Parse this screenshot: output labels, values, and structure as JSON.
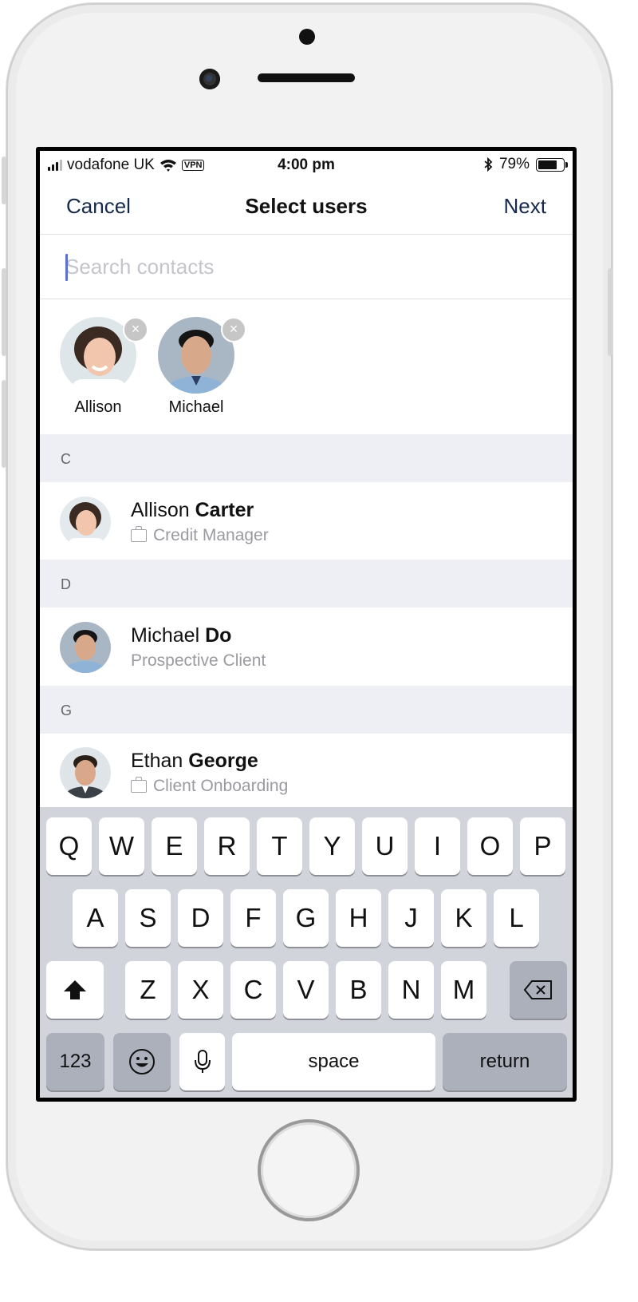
{
  "status_bar": {
    "carrier": "vodafone UK",
    "vpn": "VPN",
    "time": "4:00 pm",
    "battery": "79%",
    "battery_level": 0.79
  },
  "nav": {
    "cancel": "Cancel",
    "title": "Select users",
    "next": "Next"
  },
  "search": {
    "placeholder": "Search contacts",
    "value": ""
  },
  "selected": [
    {
      "name": "Allison"
    },
    {
      "name": "Michael"
    }
  ],
  "sections": [
    {
      "letter": "C",
      "contacts": [
        {
          "first": "Allison",
          "last": "Carter",
          "subtitle": "Credit Manager",
          "subtitle_icon": "briefcase-icon"
        }
      ]
    },
    {
      "letter": "D",
      "contacts": [
        {
          "first": "Michael",
          "last": "Do",
          "subtitle": "Prospective Client",
          "subtitle_icon": ""
        }
      ]
    },
    {
      "letter": "G",
      "contacts": [
        {
          "first": "Ethan",
          "last": "George",
          "subtitle": "Client Onboarding",
          "subtitle_icon": "briefcase-icon"
        }
      ]
    }
  ],
  "keyboard": {
    "row1": [
      "Q",
      "W",
      "E",
      "R",
      "T",
      "Y",
      "U",
      "I",
      "O",
      "P"
    ],
    "row2": [
      "A",
      "S",
      "D",
      "F",
      "G",
      "H",
      "J",
      "K",
      "L"
    ],
    "row3": [
      "Z",
      "X",
      "C",
      "V",
      "B",
      "N",
      "M"
    ],
    "numbers": "123",
    "space": "space",
    "return": "return"
  },
  "colors": {
    "accent": "#16294d",
    "section_bg": "#eeeff4",
    "keyboard_bg": "#d1d4db"
  }
}
